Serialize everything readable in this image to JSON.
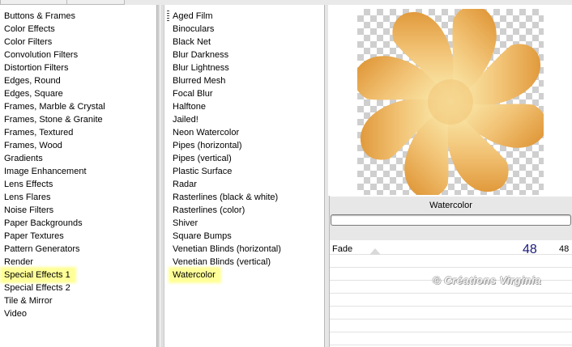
{
  "categories": [
    "Buttons & Frames",
    "Color Effects",
    "Color Filters",
    "Convolution Filters",
    "Distortion Filters",
    "Edges, Round",
    "Edges, Square",
    "Frames, Marble & Crystal",
    "Frames, Stone & Granite",
    "Frames, Textured",
    "Frames, Wood",
    "Gradients",
    "Image Enhancement",
    "Lens Effects",
    "Lens Flares",
    "Noise Filters",
    "Paper Backgrounds",
    "Paper Textures",
    "Pattern Generators",
    "Render",
    "Special Effects 1",
    "Special Effects 2",
    "Tile & Mirror",
    "Video"
  ],
  "selected_category": "Special Effects 1",
  "filters": [
    "Aged Film",
    "Binoculars",
    "Black Net",
    "Blur Darkness",
    "Blur Lightness",
    "Blurred Mesh",
    "Focal Blur",
    "Halftone",
    "Jailed!",
    "Neon Watercolor",
    "Pipes (horizontal)",
    "Pipes (vertical)",
    "Plastic Surface",
    "Radar",
    "Rasterlines (black & white)",
    "Rasterlines (color)",
    "Shiver",
    "Square Bumps",
    "Venetian Blinds (horizontal)",
    "Venetian Blinds (vertical)",
    "Watercolor"
  ],
  "selected_filter": "Watercolor",
  "preview": {
    "shape": "flower",
    "colors": {
      "light": "#fbf0b4",
      "mid": "#f2c477",
      "dark": "#e19a3c"
    }
  },
  "settings": {
    "filter_title": "Watercolor",
    "fade_label": "Fade",
    "fade_value": "48",
    "fade_max_label": "48"
  },
  "watermark": "© Créations Virginia",
  "highlight_color": "#ffff99"
}
